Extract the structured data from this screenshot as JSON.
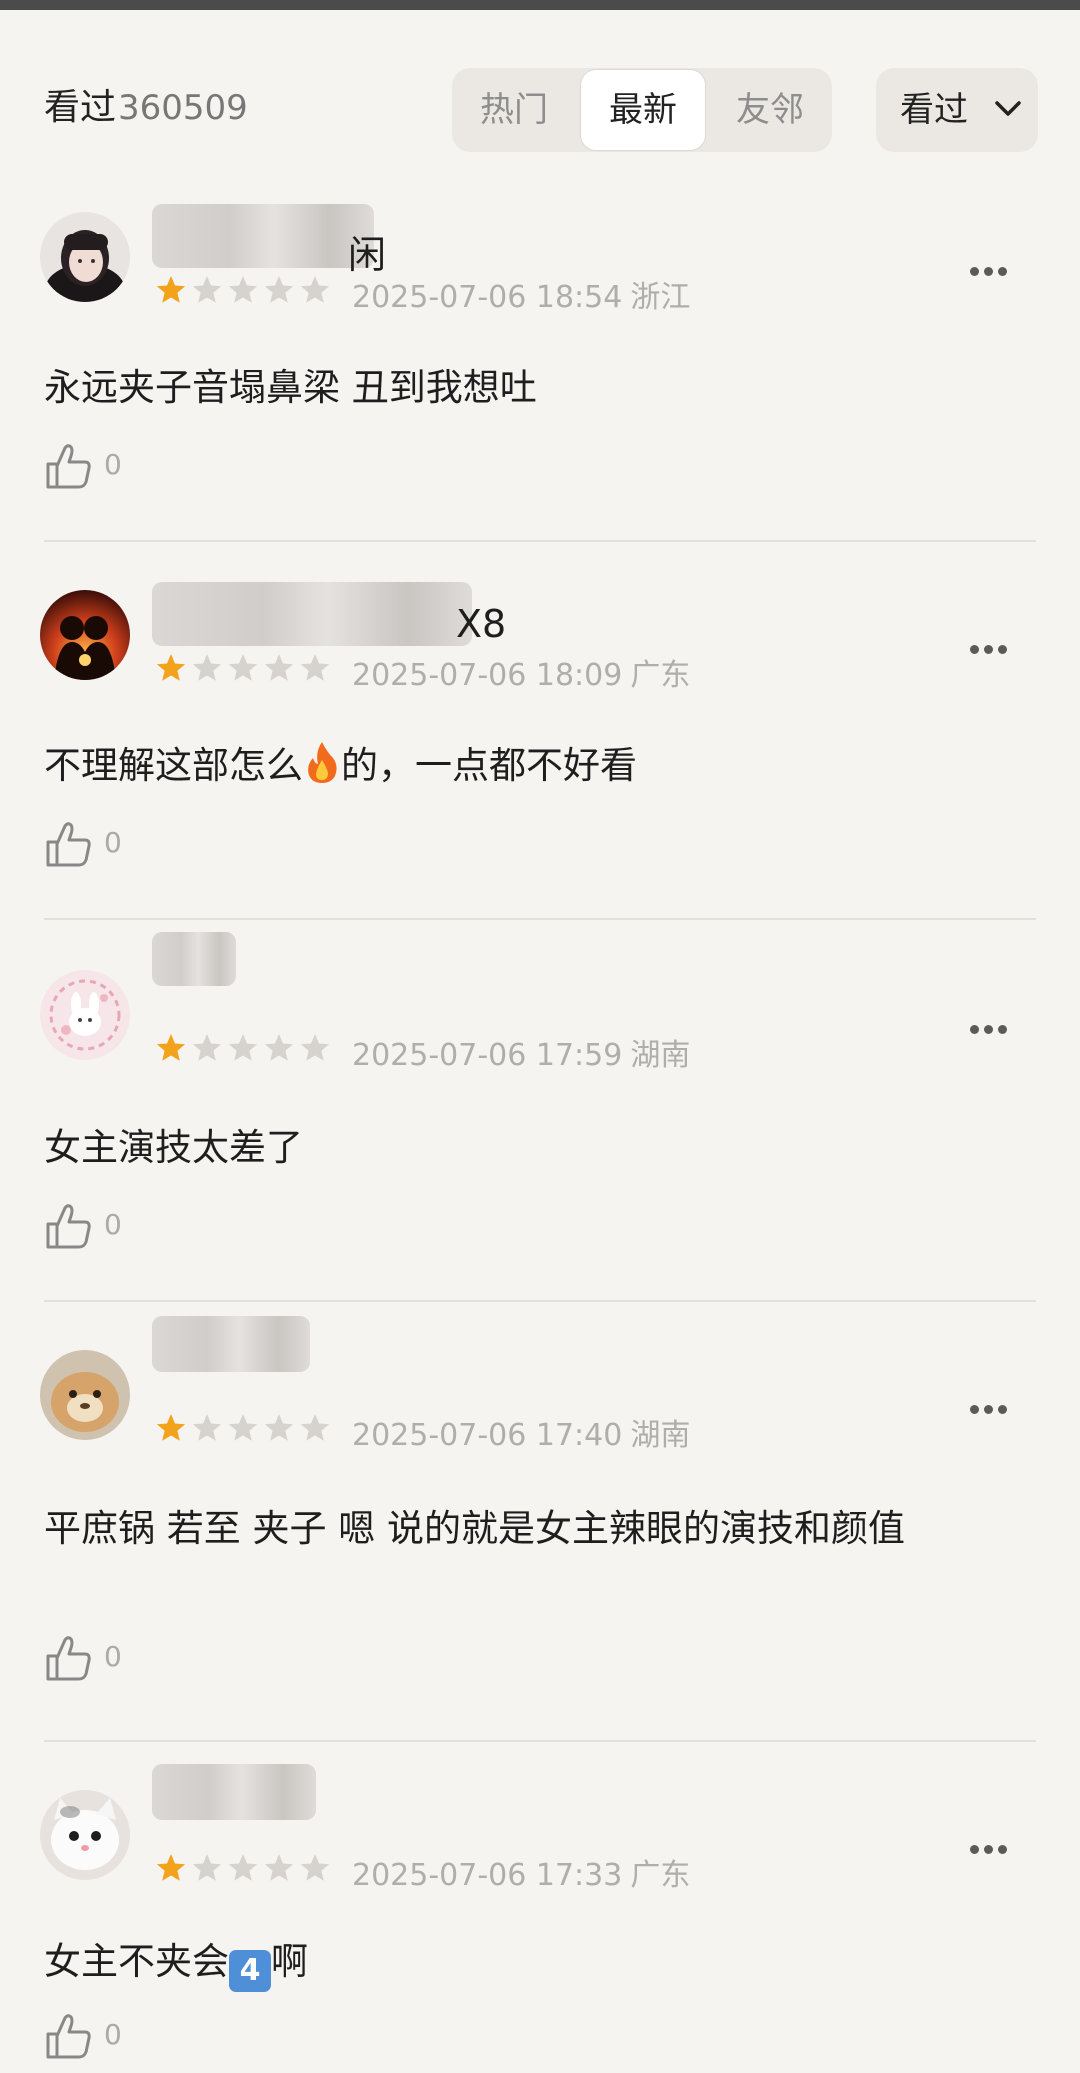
{
  "header": {
    "watched_label": "看过",
    "watched_count": "360509",
    "tabs": [
      {
        "label": "热门",
        "active": false
      },
      {
        "label": "最新",
        "active": true
      },
      {
        "label": "友邻",
        "active": false
      }
    ],
    "filter_label": "看过"
  },
  "rating_star_color": "#f2a31b",
  "empty_star_color": "#d6d3cf",
  "comments": [
    {
      "name_visible": "闲",
      "rating": 1,
      "date": "2025-07-06 18:54",
      "location": "浙江",
      "text": "永远夹子音塌鼻梁 丑到我想吐",
      "likes": "0"
    },
    {
      "name_visible": "X8",
      "rating": 1,
      "date": "2025-07-06 18:09",
      "location": "广东",
      "text_before": "不理解这部怎么",
      "text_after": "的，一点都不好看",
      "likes": "0"
    },
    {
      "name_visible": "",
      "rating": 1,
      "date": "2025-07-06 17:59",
      "location": "湖南",
      "text": "女主演技太差了",
      "likes": "0"
    },
    {
      "name_visible": "",
      "rating": 1,
      "date": "2025-07-06 17:40",
      "location": "湖南",
      "text": "平庶锅 若至 夹子 嗯 说的就是女主辣眼的演技和颜值",
      "likes": "0"
    },
    {
      "name_visible": "",
      "rating": 1,
      "date": "2025-07-06 17:33",
      "location": "广东",
      "text_before": "女主不夹会",
      "emoji": "4",
      "text_after": "啊",
      "likes": "0"
    }
  ]
}
